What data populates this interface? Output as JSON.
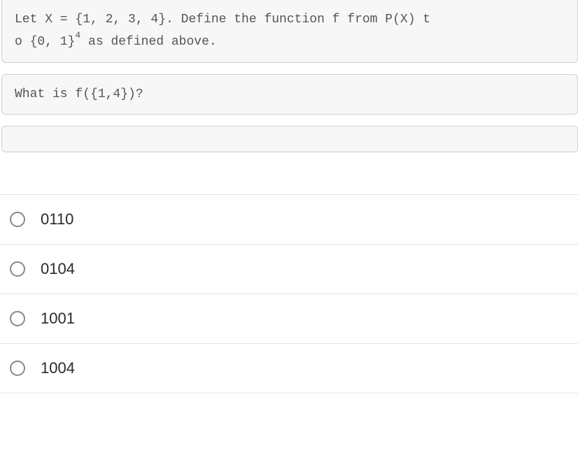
{
  "context": {
    "line1_part1": "Let X = {1, 2, 3, 4}. Define the function f from P(X) t",
    "line2_part1": "o {0, 1}",
    "line2_sup": "4",
    "line2_part2": " as defined above."
  },
  "question": "What is f({1,4})?",
  "options": [
    {
      "label": "0110"
    },
    {
      "label": "0104"
    },
    {
      "label": "1001"
    },
    {
      "label": "1004"
    }
  ]
}
